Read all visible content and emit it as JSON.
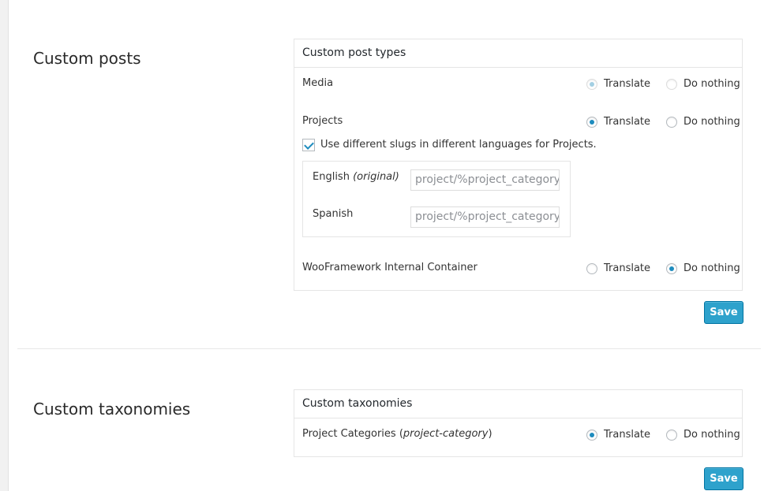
{
  "colors": {
    "accent": "#1e8cbe",
    "button": "#2ea2cc"
  },
  "posts": {
    "section_title": "Custom posts",
    "box_title": "Custom post types",
    "option_translate": "Translate",
    "option_nothing": "Do nothing",
    "rows": [
      {
        "label": "Media",
        "selected": "Translate",
        "disabled": true
      },
      {
        "label": "Projects",
        "selected": "Translate"
      },
      {
        "label": "WooFramework Internal Container",
        "selected": "Do nothing"
      }
    ],
    "slug_checkbox_label": "Use different slugs in different languages for Projects.",
    "slug_checked": true,
    "slugs": [
      {
        "lang": "English",
        "note": "(original)",
        "value": "project/%project_category%"
      },
      {
        "lang": "Spanish",
        "value": "project/%project_category%"
      }
    ],
    "save_label": "Save"
  },
  "taxonomies": {
    "section_title": "Custom taxonomies",
    "box_title": "Custom taxonomies",
    "option_translate": "Translate",
    "option_nothing": "Do nothing",
    "rows": [
      {
        "label": "Project Categories",
        "slug": "project-category",
        "selected": "Translate"
      }
    ],
    "save_label": "Save"
  }
}
